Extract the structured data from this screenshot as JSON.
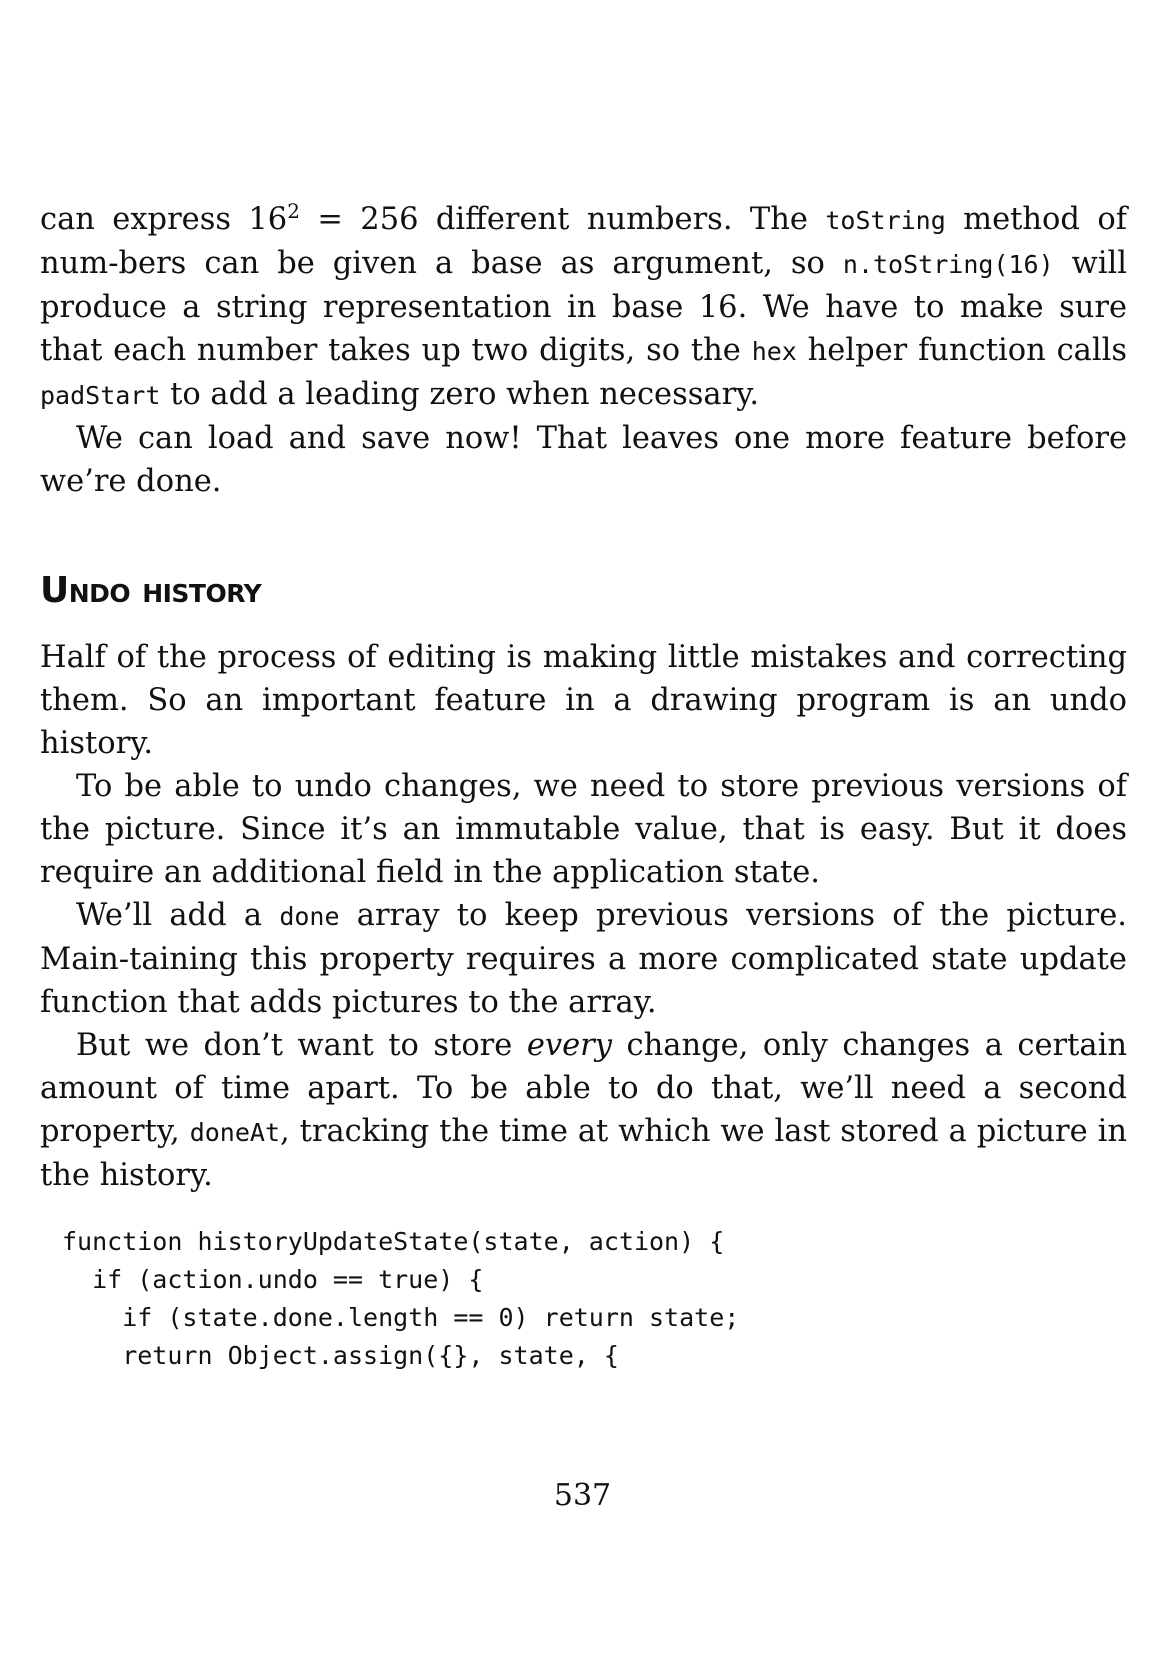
{
  "paragraphs_top": {
    "p1_a": "can express 16",
    "p1_sup": "2",
    "p1_b": " = 256 different numbers. The ",
    "p1_code1": "toString",
    "p1_c": " method of num-bers can be given a base as argument, so ",
    "p1_code2": "n.toString(16)",
    "p1_d": " will produce a string representation in base 16. We have to make sure that each number takes up two digits, so the ",
    "p1_code3": "hex",
    "p1_e": " helper function calls ",
    "p1_code4": "padStart",
    "p1_f": " to add a leading zero when necessary.",
    "p2": "We can load and save now! That leaves one more feature before we’re done."
  },
  "section": {
    "heading": "Undo history"
  },
  "paragraphs_section": {
    "p3": "Half of the process of editing is making little mistakes and correcting them. So an important feature in a drawing program is an undo history.",
    "p4": "To be able to undo changes, we need to store previous versions of the picture. Since it’s an immutable value, that is easy. But it does require an additional field in the application state.",
    "p5_a": "We’ll add a ",
    "p5_code": "done",
    "p5_b": " array to keep previous versions of the picture. Main-taining this property requires a more complicated state update function that adds pictures to the array.",
    "p6_a": "But we don’t want to store ",
    "p6_em": "every",
    "p6_b": " change, only changes a certain amount of time apart. To be able to do that, we’ll need a second property, ",
    "p6_code": "doneAt",
    "p6_c": ", tracking the time at which we last stored a picture in the history."
  },
  "code_block": {
    "line1": "function historyUpdateState(state, action) {",
    "line2": "  if (action.undo == true) {",
    "line3": "    if (state.done.length == 0) return state;",
    "line4": "    return Object.assign({}, state, {"
  },
  "footer": {
    "page_number": "537"
  }
}
